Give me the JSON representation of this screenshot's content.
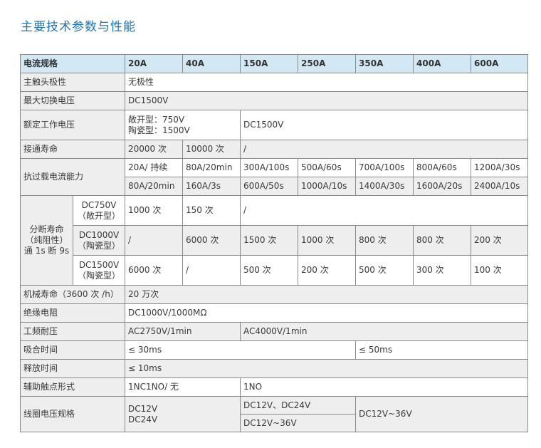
{
  "title": "主要技术参数与性能",
  "header": {
    "label": "电流规格",
    "ratings": [
      "20A",
      "40A",
      "150A",
      "250A",
      "350A",
      "400A",
      "600A"
    ]
  },
  "rows": {
    "polarity": {
      "label": "主触头极性",
      "value": "无极性"
    },
    "max_voltage": {
      "label": "最大切换电压",
      "value": "DC1500V"
    },
    "rated_voltage": {
      "label": "额定工作电压",
      "open_type": "敞开型：750V",
      "ceramic_type": "陶瓷型：1500V",
      "high": "DC1500V"
    },
    "make_life": {
      "label": "接通寿命",
      "v20": "20000 次",
      "v40": "10000 次",
      "rest": "/"
    },
    "overload": {
      "label": "抗过载电流能力",
      "line1": [
        "20A/ 持续",
        "80A/20min",
        "300A/100s",
        "500A/60s",
        "700A/100s",
        "800A/60s",
        "1200A/30s"
      ],
      "line2": [
        "80A/20min",
        "160A/3s",
        "600A/50s",
        "1000A/10s",
        "1400A/30s",
        "1600A/20s",
        "2400A/10s"
      ]
    },
    "break_life": {
      "label_line1": "分断寿命",
      "label_line2": "（纯阻性）",
      "label_line3": "通 1s 断 9s",
      "sub1": {
        "v": "DC750V",
        "t": "（敞开型）",
        "values": [
          "1000 次",
          "150 次",
          "/"
        ]
      },
      "sub2": {
        "v": "DC1000V",
        "t": "（陶瓷型）",
        "values": [
          "/",
          "6000 次",
          "1500 次",
          "1000 次",
          "800 次",
          "800 次",
          "200 次"
        ]
      },
      "sub3": {
        "v": "DC1500V",
        "t": "（陶瓷型）",
        "values": [
          "6000 次",
          "/",
          "500 次",
          "200 次",
          "500 次",
          "300 次",
          "100 次"
        ]
      }
    },
    "mech_life": {
      "label": "机械寿命（3600 次 /h）",
      "value": "20 万次"
    },
    "insulation": {
      "label": "绝缘电阻",
      "value": "DC1000V/1000MΩ"
    },
    "withstand": {
      "label": "工频耐压",
      "low": "AC2750V/1min",
      "high": "AC4000V/1min"
    },
    "pickup": {
      "label": "吸合时间",
      "low": "≤ 30ms",
      "high": "≤ 50ms"
    },
    "release": {
      "label": "释放时间",
      "value": "≤ 10ms"
    },
    "aux": {
      "label": "辅助触点形式",
      "low": "1NC1NO/ 无",
      "high": "1NO"
    },
    "coil": {
      "label": "线圈电压规格",
      "low1": "DC12V",
      "low2": "DC24V",
      "mid1": "DC12V、DC24V",
      "mid2": "DC12V~36V",
      "high": "DC12V~36V"
    }
  }
}
